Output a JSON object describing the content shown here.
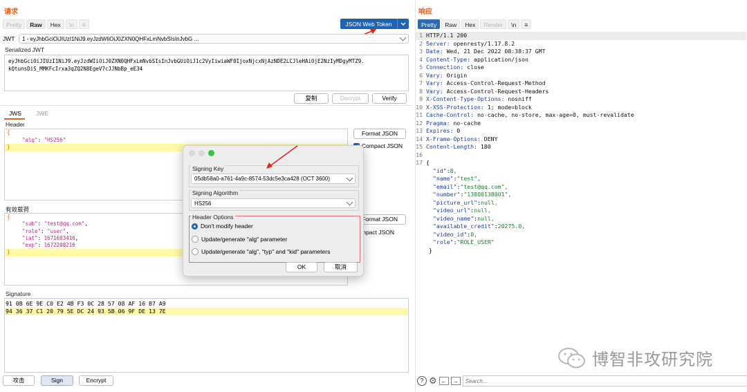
{
  "request": {
    "title": "请求",
    "tabs": [
      {
        "label": "Pretty",
        "state": "dim"
      },
      {
        "label": "Raw",
        "state": "active"
      },
      {
        "label": "Hex",
        "state": "normal"
      },
      {
        "label": "\\n",
        "state": "dim"
      },
      {
        "label": "≡",
        "state": "dim"
      }
    ],
    "jwt_button": "JSON Web Token",
    "jwt_label": "JWT",
    "jwt_select": "1 - eyJhbGciOiJIUzI1NiJ9.eyJzdWIiOiJ0ZXN0QHFxLmNvbSIsInJvbG ...",
    "serialized_label": "Serialized JWT",
    "serialized_lines": [
      "eyJhbGciOiJIUzI1NiJ9.eyJzdWIiOiJ0ZXN0QHFxLmNvbSIsInJvbGUiOiJ1c2VyIiwiaWF0IjoxNjcxNjAzNDE2LCJleHAiOjE2NzIyMDgyMTZ9.",
      "kQtunsDiS_MMKFcIrxa3qZQ2N8EgeV7cJJNbBp_eE34"
    ],
    "buttons": {
      "copy": "复制",
      "decrypt": "Decrypt",
      "verify": "Verify"
    },
    "sub_tabs": [
      "JWS",
      "JWE"
    ],
    "header_label": "Header",
    "header_json": {
      "alg_key": "\"alg\"",
      "alg_val": "\"HS256\""
    },
    "format_json": "Format JSON",
    "compact_json": "Compact JSON",
    "payload_label": "有效载荷",
    "payload_json": {
      "sub_key": "\"sub\"",
      "sub_val": "\"test@qq.com\"",
      "role_key": "\"role\"",
      "role_val": "\"user\"",
      "iat_key": "\"iat\"",
      "iat_val": "1671603416",
      "exp_key": "\"exp\"",
      "exp_val": "1672208216"
    },
    "signature_label": "Signature",
    "signature_lines": [
      "91 0B 6E 9E C0 E2 4B F3 0C 28 57 08 AF 16 B7 A9",
      "94 36 37 C1 20 79 5E DC 24 93 5B 06 9F DE 13 7E"
    ],
    "bottom_buttons": {
      "attack": "攻击",
      "sign": "Sign",
      "encrypt": "Encrypt"
    }
  },
  "dialog": {
    "signing_key_label": "Signing Key",
    "signing_key_value": "05db58a0-a761-4a9c-8574-53dc5e3ca428 (OCT 3600)",
    "signing_alg_label": "Signing Algorithm",
    "signing_alg_value": "HS256",
    "header_options_label": "Header Options",
    "options": [
      {
        "label": "Don't modify header",
        "selected": true
      },
      {
        "label": "Update/generate \"alg\" parameter",
        "selected": false
      },
      {
        "label": "Update/generate \"alg\", \"typ\" and \"kid\" parameters",
        "selected": false
      }
    ],
    "ok": "OK",
    "cancel": "取消"
  },
  "response": {
    "title": "响应",
    "tabs": [
      {
        "label": "Pretty",
        "state": "blue"
      },
      {
        "label": "Raw",
        "state": "normal"
      },
      {
        "label": "Hex",
        "state": "normal"
      },
      {
        "label": "Render",
        "state": "dim"
      },
      {
        "label": "\\n",
        "state": "normal"
      },
      {
        "label": "≡",
        "state": "normal"
      }
    ],
    "lines": [
      {
        "n": "1",
        "k": "HTTP/1.1 200",
        "v": ""
      },
      {
        "n": "2",
        "k": "Server:",
        "v": " openresty/1.17.8.2"
      },
      {
        "n": "3",
        "k": "Date:",
        "v": " Wed, 21 Dec 2022 08:38:37 GMT"
      },
      {
        "n": "4",
        "k": "Content-Type:",
        "v": " application/json"
      },
      {
        "n": "5",
        "k": "Connection:",
        "v": " close"
      },
      {
        "n": "6",
        "k": "Vary:",
        "v": " Origin"
      },
      {
        "n": "7",
        "k": "Vary:",
        "v": " Access-Control-Request-Method"
      },
      {
        "n": "8",
        "k": "Vary:",
        "v": " Access-Control-Request-Headers"
      },
      {
        "n": "9",
        "k": "X-Content-Type-Options:",
        "v": " nosniff"
      },
      {
        "n": "10",
        "k": "X-XSS-Protection:",
        "v": " 1; mode=block"
      },
      {
        "n": "11",
        "k": "Cache-Control:",
        "v": " no-cache, no-store, max-age=0, must-revalidate"
      },
      {
        "n": "12",
        "k": "Pragma:",
        "v": " no-cache"
      },
      {
        "n": "13",
        "k": "Expires:",
        "v": " 0"
      },
      {
        "n": "14",
        "k": "X-Frame-Options:",
        "v": " DENY"
      },
      {
        "n": "15",
        "k": "Content-Length:",
        "v": " 180"
      },
      {
        "n": "16",
        "k": "",
        "v": ""
      },
      {
        "n": "17",
        "k": "{",
        "v": ""
      }
    ],
    "json_lines": [
      {
        "k": "\"id\"",
        "v": "8,"
      },
      {
        "k": "\"name\"",
        "v": "\"test\","
      },
      {
        "k": "\"email\"",
        "v": "\"test@qq.com\","
      },
      {
        "k": "\"number\"",
        "v": "\"13800138001\","
      },
      {
        "k": "\"picture_url\"",
        "v": "null,"
      },
      {
        "k": "\"video_url\"",
        "v": "null,"
      },
      {
        "k": "\"video_name\"",
        "v": "null,"
      },
      {
        "k": "\"available_credit\"",
        "v": "20275.0,"
      },
      {
        "k": "\"video_id\"",
        "v": "0,"
      },
      {
        "k": "\"role\"",
        "v": "\"ROLE_USER\""
      }
    ],
    "closing": "}",
    "search_placeholder": "Search...",
    "watermark": "博智非攻研究院"
  }
}
